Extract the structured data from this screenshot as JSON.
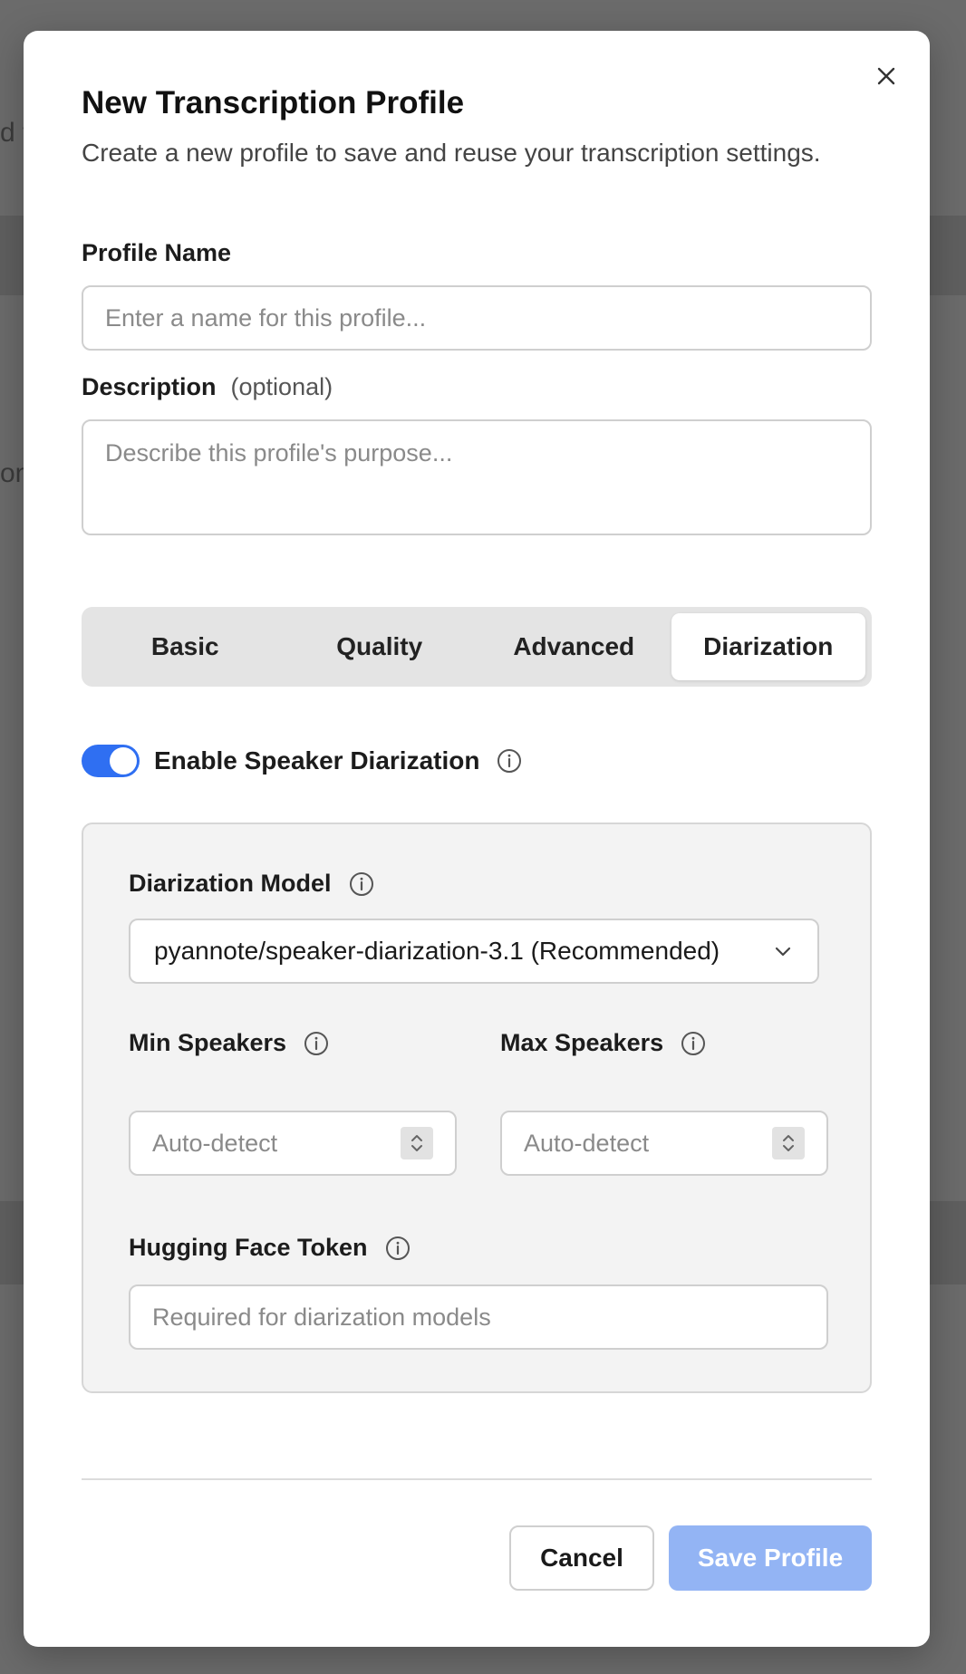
{
  "background": {
    "frag_1": "d t",
    "frag_2": "on"
  },
  "dialog": {
    "title": "New Transcription Profile",
    "subtitle": "Create a new profile to save and reuse your transcription settings.",
    "close_icon": "close-icon"
  },
  "profile_name": {
    "label": "Profile Name",
    "value": "",
    "placeholder": "Enter a name for this profile..."
  },
  "description": {
    "label": "Description",
    "optional_label": "(optional)",
    "value": "",
    "placeholder": "Describe this profile's purpose..."
  },
  "tabs": [
    {
      "label": "Basic",
      "active": false
    },
    {
      "label": "Quality",
      "active": false
    },
    {
      "label": "Advanced",
      "active": false
    },
    {
      "label": "Diarization",
      "active": true
    }
  ],
  "diarization": {
    "enable_label": "Enable Speaker Diarization",
    "enabled": true,
    "model_label": "Diarization Model",
    "model_value": "pyannote/speaker-diarization-3.1 (Recommended)",
    "min_speakers_label": "Min Speakers",
    "min_speakers_placeholder": "Auto-detect",
    "max_speakers_label": "Max Speakers",
    "max_speakers_placeholder": "Auto-detect",
    "hf_token_label": "Hugging Face Token",
    "hf_token_placeholder": "Required for diarization models"
  },
  "footer": {
    "cancel_label": "Cancel",
    "save_label": "Save Profile"
  },
  "colors": {
    "accent": "#2f6ff2",
    "save_disabled": "#93b4f4",
    "overlay": "#6b6b6b"
  }
}
